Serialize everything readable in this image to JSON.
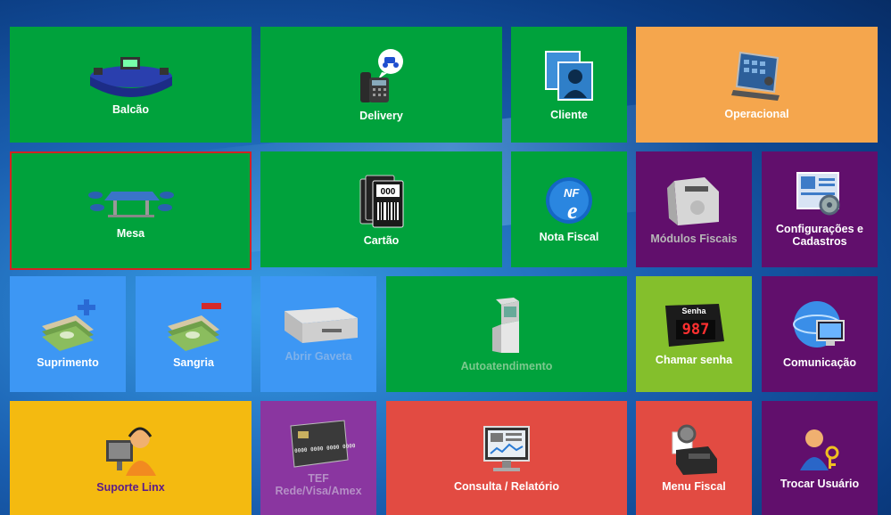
{
  "tiles": {
    "balcao": {
      "label": "Balcão",
      "icon": "counter-icon"
    },
    "delivery": {
      "label": "Delivery",
      "icon": "phone-delivery-icon"
    },
    "cliente": {
      "label": "Cliente",
      "icon": "client-cards-icon"
    },
    "operacional": {
      "label": "Operacional",
      "icon": "control-panel-icon"
    },
    "mesa": {
      "label": "Mesa",
      "icon": "table-icon"
    },
    "cartao": {
      "label": "Cartão",
      "icon": "barcode-cards-icon"
    },
    "nota_fiscal": {
      "label": "Nota Fiscal",
      "icon": "nfe-icon"
    },
    "modulos_fiscais": {
      "label": "Módulos Fiscais",
      "icon": "fiscal-printer-icon"
    },
    "configuracoes": {
      "label_line1": "Configurações e",
      "label_line2": "Cadastros",
      "icon": "settings-screen-icon"
    },
    "suprimento": {
      "label": "Suprimento",
      "icon": "money-plus-icon"
    },
    "sangria": {
      "label": "Sangria",
      "icon": "money-minus-icon"
    },
    "abrir_gaveta": {
      "label": "Abrir Gaveta",
      "icon": "cash-drawer-icon"
    },
    "autoatendimento": {
      "label": "Autoatendimento",
      "icon": "kiosk-icon"
    },
    "chamar_senha": {
      "label": "Chamar senha",
      "icon": "ticket-display-icon",
      "display_title": "Senha",
      "display_number": "987"
    },
    "comunicacao": {
      "label": "Comunicação",
      "icon": "globe-monitor-icon"
    },
    "suporte": {
      "label": "Suporte Linx",
      "icon": "support-agent-icon"
    },
    "tef": {
      "label_line1": "TEF",
      "label_line2": "Rede/Visa/Amex",
      "icon": "credit-card-icon",
      "card_number": "0000 0000 0000 0000"
    },
    "consulta": {
      "label": "Consulta / Relatório",
      "icon": "report-monitor-icon"
    },
    "menu_fiscal": {
      "label": "Menu Fiscal",
      "icon": "fiscal-menu-icon"
    },
    "trocar_usuario": {
      "label": "Trocar Usuário",
      "icon": "user-key-icon"
    }
  }
}
